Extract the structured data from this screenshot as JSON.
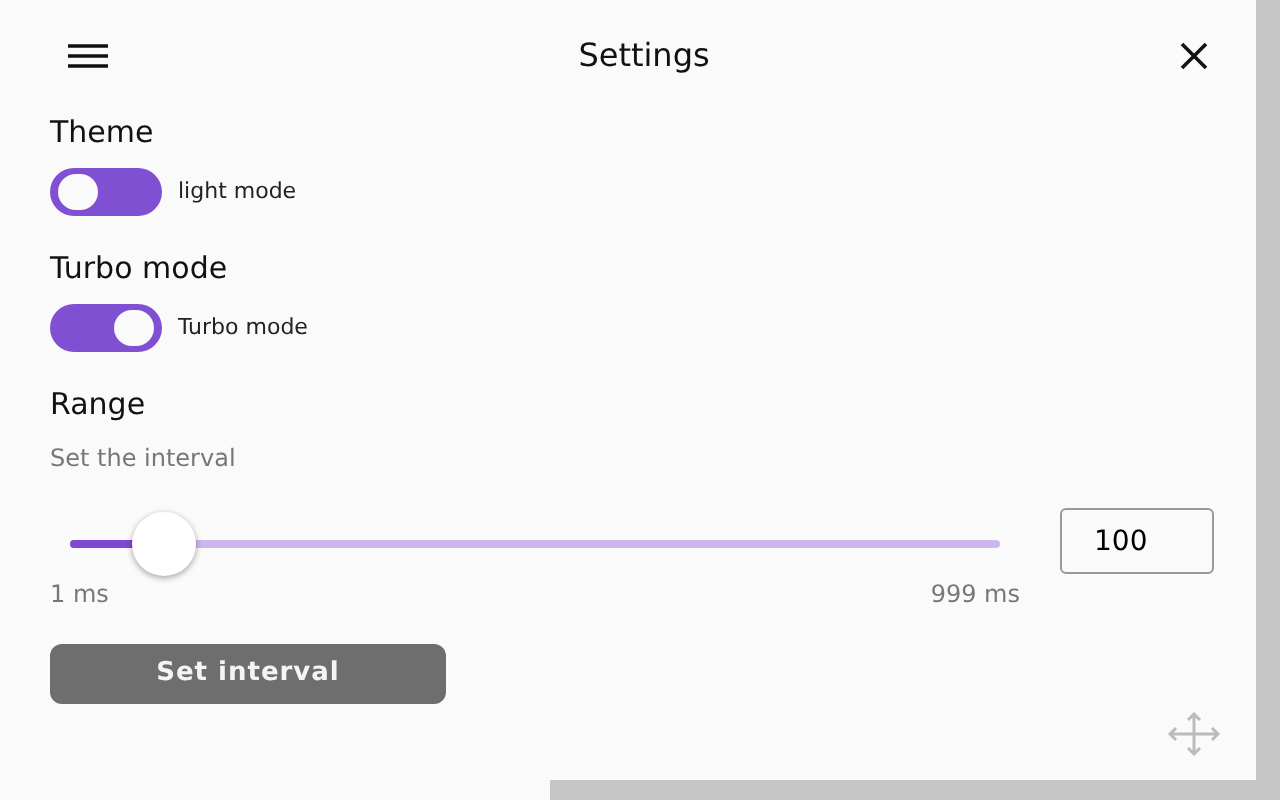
{
  "header": {
    "title": "Settings"
  },
  "sections": [
    {
      "kind": "toggle",
      "heading": "Theme",
      "on": false,
      "label": "light mode"
    },
    {
      "kind": "toggle",
      "heading": "Turbo mode",
      "on": true,
      "label": "Turbo mode"
    },
    {
      "kind": "range",
      "heading": "Range",
      "hint": "Set the interval",
      "level": 0.1,
      "min_label": "1 ms",
      "max_label": "999 ms",
      "value": "100",
      "button": "Set interval"
    }
  ]
}
